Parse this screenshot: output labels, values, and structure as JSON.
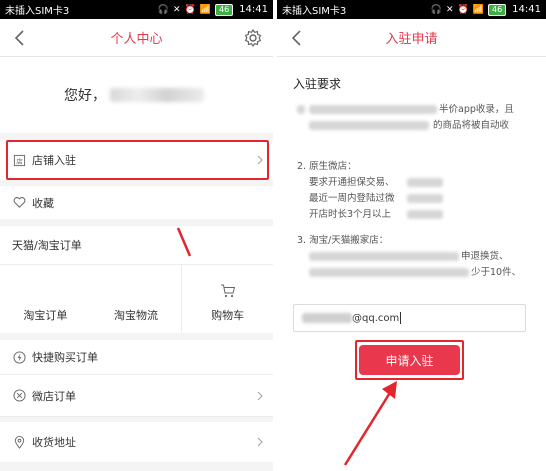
{
  "left_screen": {
    "status": {
      "carrier": "未插入SIM卡3",
      "time": "14:41",
      "battery": "46"
    },
    "nav_title": "个人中心",
    "greeting": "您好，",
    "menu": {
      "shop_settle": "店铺入驻",
      "favorites": "收藏",
      "tmall_orders": "天猫/淘宝订单",
      "taobao_orders": "淘宝订单",
      "taobao_logistics": "淘宝物流",
      "cart": "购物车",
      "quick_buy_orders": "快捷购买订单",
      "weidian_orders": "微店订单",
      "shipping_address": "收货地址"
    }
  },
  "right_screen": {
    "status": {
      "carrier": "未插入SIM卡3",
      "time": "14:41",
      "battery": "46"
    },
    "nav_title": "入驻申请",
    "section_title": "入驻要求",
    "req1": {
      "frag1": "半价app收录，且",
      "frag2": "的商品将被自动收"
    },
    "req2": {
      "line1": "2.  原生微店：",
      "line2": "要求开通担保交易、",
      "line3": "最近一周内登陆过微",
      "line4": "开店时长3个月以上"
    },
    "req3": {
      "line1": "3.  淘宝/天猫搬家店：",
      "frag1": "申退换货、",
      "frag2": "少于10件、"
    },
    "email_suffix": "@qq.com",
    "apply_button": "申请入驻"
  },
  "colors": {
    "accent": "#e4394b",
    "highlight": "#e3262d",
    "button": "#e9384d"
  }
}
